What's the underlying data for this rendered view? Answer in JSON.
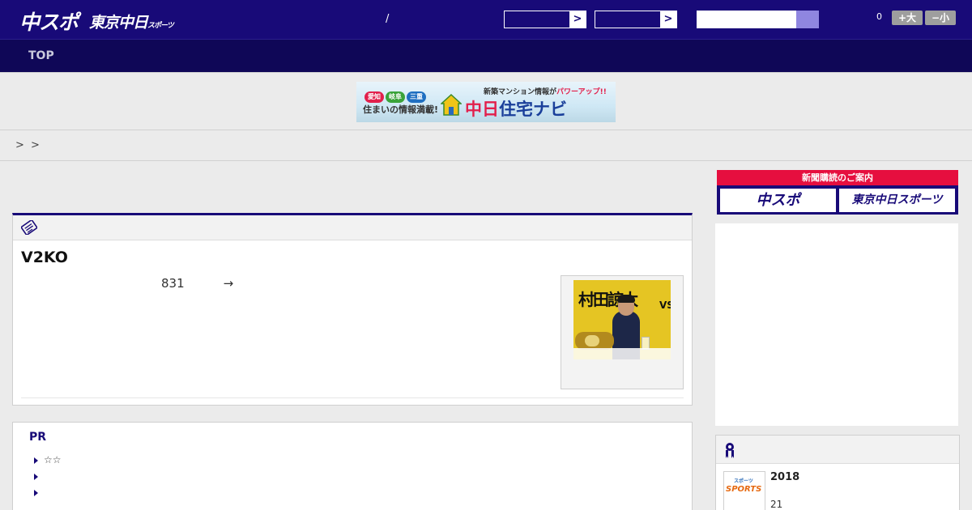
{
  "header": {
    "logo_main": "中スポ",
    "logo_sub": "東京中日",
    "logo_sub_small": "スポーツ",
    "separator": "/",
    "select1_arrow": ">",
    "select2_arrow": ">",
    "search_placeholder": "",
    "count": "0",
    "font_larger": "+大",
    "font_smaller": "−小"
  },
  "nav": {
    "top": "TOP"
  },
  "banner": {
    "pill1": "愛知",
    "pill2": "岐阜",
    "pill3": "三重",
    "tagline": "住まいの情報満載!",
    "headline": "新築マンション情報が",
    "headline_power": "パワーアップ!!",
    "brand_a": "中日",
    "brand_b": "住宅ナビ",
    "colors": {
      "pill1": "#e2204c",
      "pill2": "#3aa33a",
      "pill3": "#1f6fc1"
    }
  },
  "breadcrumb": {
    "text": "> >"
  },
  "article": {
    "title": "V2KO",
    "body_num": "831",
    "body_arrow": "→",
    "thumb_name": "村田諒太",
    "thumb_vs": "VS"
  },
  "pr": {
    "title": "PR",
    "items": [
      "☆☆",
      "",
      ""
    ]
  },
  "sidebar": {
    "subscription_title": "新聞購読のご案内",
    "sub_btn1": "中スポ",
    "sub_btn2": "東京中日スポーツ",
    "card_year": "2018",
    "card_num": "21",
    "thumb_label": "SPORTS",
    "thumb_small": "スポーツ"
  },
  "colors": {
    "header_bg": "#180a78",
    "nav_bg": "#0f0757",
    "accent_red": "#e60f3f",
    "search_btn": "#8f86e0"
  }
}
